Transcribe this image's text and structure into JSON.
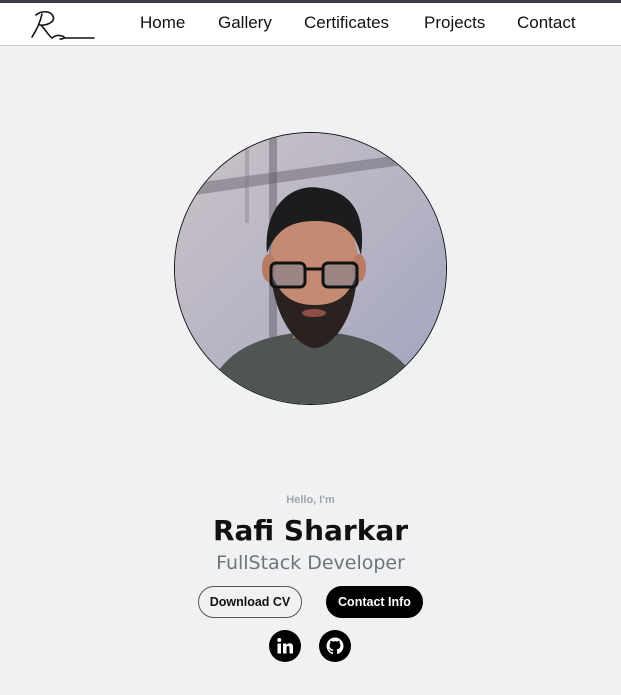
{
  "nav": {
    "logo_text": "Rs",
    "items": [
      "Home",
      "Gallery",
      "Certificates",
      "Projects",
      "Contact"
    ]
  },
  "hero": {
    "greeting": "Hello, I'm",
    "name": "Rafi Sharkar",
    "role": "FullStack Developer",
    "download_cv_label": "Download CV",
    "contact_info_label": "Contact Info"
  },
  "social": {
    "linkedin_icon": "linkedin-icon",
    "github_icon": "github-icon"
  },
  "colors": {
    "background": "#f0f1f3",
    "navbar": "#ffffff",
    "text": "#111111",
    "muted": "#6f747b",
    "accent_button": "#000000"
  }
}
